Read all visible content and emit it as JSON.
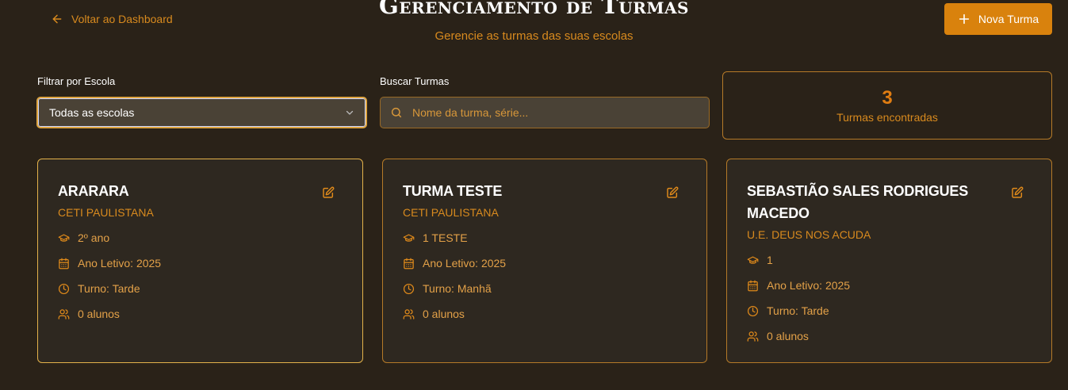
{
  "header": {
    "back_label": "Voltar ao Dashboard",
    "title": "Gerenciamento de Turmas",
    "subtitle": "Gerencie as turmas das suas escolas",
    "new_button_label": "Nova Turma"
  },
  "filters": {
    "school_label": "Filtrar por Escola",
    "school_selected": "Todas as escolas",
    "search_label": "Buscar Turmas",
    "search_placeholder": "Nome da turma, série...",
    "search_value": ""
  },
  "summary": {
    "count": "3",
    "count_label": "Turmas encontradas"
  },
  "cards": [
    {
      "title": "ARARARA",
      "school": "CETI PAULISTANA",
      "grade": "2º ano",
      "year": "Ano Letivo: 2025",
      "shift": "Turno: Tarde",
      "students": "0 alunos"
    },
    {
      "title": "TURMA TESTE",
      "school": "CETI PAULISTANA",
      "grade": "1 TESTE",
      "year": "Ano Letivo: 2025",
      "shift": "Turno: Manhã",
      "students": "0 alunos"
    },
    {
      "title": "SEBASTIÃO SALES RODRIGUES MACEDO",
      "school": "U.E. DEUS NOS ACUDA",
      "grade": "1",
      "year": "Ano Letivo: 2025",
      "shift": "Turno: Tarde",
      "students": "0 alunos"
    }
  ],
  "icons": {
    "back": "arrow-left-icon",
    "new": "plus-icon",
    "select": "chevron-down-icon",
    "search": "search-icon",
    "edit": "edit-icon",
    "grade": "graduation-cap-icon",
    "year": "calendar-icon",
    "shift": "clock-icon",
    "students": "users-icon"
  },
  "colors": {
    "background": "#2a2218",
    "accent": "#d9820d",
    "card_border": "#b57a28",
    "text_accent": "#e8a23c"
  }
}
